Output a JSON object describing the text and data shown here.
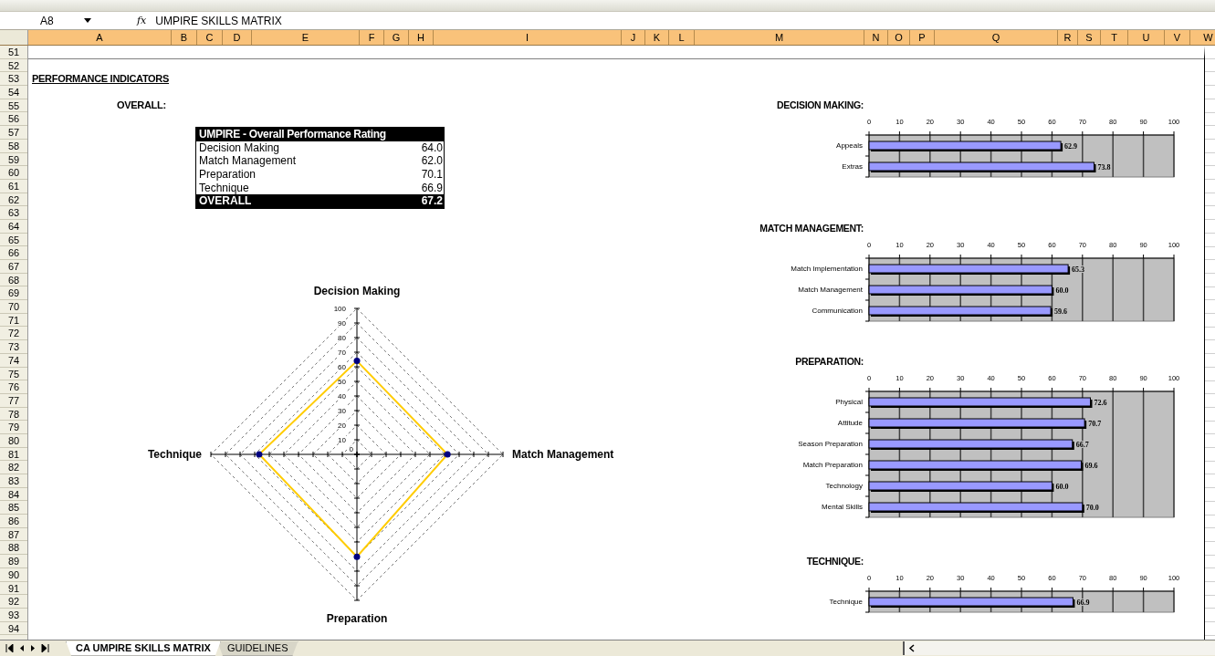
{
  "formula_bar": {
    "name_box": "A8",
    "function_label": "fx",
    "formula": "UMPIRE SKILLS MATRIX"
  },
  "columns": [
    "A",
    "B",
    "C",
    "D",
    "E",
    "F",
    "G",
    "H",
    "I",
    "J",
    "K",
    "L",
    "M",
    "N",
    "O",
    "P",
    "Q",
    "R",
    "S",
    "T",
    "U",
    "V",
    "W"
  ],
  "rows": [
    "51",
    "52",
    "53",
    "54",
    "55",
    "56",
    "57",
    "58",
    "59",
    "60",
    "61",
    "62",
    "63",
    "64",
    "65",
    "66",
    "67",
    "68",
    "69",
    "70",
    "71",
    "72",
    "73",
    "74",
    "75",
    "76",
    "77",
    "78",
    "79",
    "80",
    "81",
    "82",
    "83",
    "84",
    "85",
    "86",
    "87",
    "88",
    "89",
    "90",
    "91",
    "92",
    "93",
    "94"
  ],
  "heading": "PERFORMANCE INDICATORS",
  "overall_label": "OVERALL:",
  "rating_table": {
    "title": "UMPIRE - Overall Performance Rating",
    "rows": [
      {
        "label": "Decision Making",
        "value": "64.0"
      },
      {
        "label": "Match Management",
        "value": "62.0"
      },
      {
        "label": "Preparation",
        "value": "70.1"
      },
      {
        "label": "Technique",
        "value": "66.9"
      }
    ],
    "total": {
      "label": "OVERALL",
      "value": "67.2"
    }
  },
  "radar_chart": {
    "chart_data": {
      "type": "radar",
      "categories": [
        "Decision Making",
        "Match Management",
        "Preparation",
        "Technique"
      ],
      "series": [
        {
          "color": "#ffcc00",
          "values": [
            64.0,
            62.0,
            70.1,
            66.9
          ]
        }
      ],
      "ylim": [
        0,
        100
      ],
      "yticks": [
        0,
        10,
        20,
        30,
        40,
        50,
        60,
        70,
        80,
        90,
        100
      ]
    }
  },
  "skill_charts": [
    {
      "heading": "DECISION MAKING:",
      "chart_data": {
        "type": "bar",
        "orientation": "horizontal",
        "categories": [
          "Appeals",
          "Extras"
        ],
        "values": [
          62.9,
          73.8
        ],
        "xlim": [
          0,
          100
        ],
        "xticks": [
          0,
          10,
          20,
          30,
          40,
          50,
          60,
          70,
          80,
          90,
          100
        ],
        "grid": true,
        "value_labels": [
          "62.9",
          "73.8"
        ]
      }
    },
    {
      "heading": "MATCH MANAGEMENT:",
      "chart_data": {
        "type": "bar",
        "orientation": "horizontal",
        "categories": [
          "Match Implementation",
          "Match Management",
          "Communication"
        ],
        "values": [
          65.3,
          60.0,
          59.6
        ],
        "xlim": [
          0,
          100
        ],
        "xticks": [
          0,
          10,
          20,
          30,
          40,
          50,
          60,
          70,
          80,
          90,
          100
        ],
        "grid": true,
        "value_labels": [
          "65.3",
          "60.0",
          "59.6"
        ]
      }
    },
    {
      "heading": "PREPARATION:",
      "chart_data": {
        "type": "bar",
        "orientation": "horizontal",
        "categories": [
          "Physical",
          "Attitude",
          "Season Preparation",
          "Match Preparation",
          "Technology",
          "Mental Skills"
        ],
        "values": [
          72.6,
          70.7,
          66.7,
          69.6,
          60.0,
          70.0
        ],
        "xlim": [
          0,
          100
        ],
        "xticks": [
          0,
          10,
          20,
          30,
          40,
          50,
          60,
          70,
          80,
          90,
          100
        ],
        "grid": true,
        "value_labels": [
          "72.6",
          "70.7",
          "66.7",
          "69.6",
          "60.0",
          "70.0"
        ]
      }
    },
    {
      "heading": "TECHNIQUE:",
      "chart_data": {
        "type": "bar",
        "orientation": "horizontal",
        "categories": [
          "Technique"
        ],
        "values": [
          66.9
        ],
        "xlim": [
          0,
          100
        ],
        "xticks": [
          0,
          10,
          20,
          30,
          40,
          50,
          60,
          70,
          80,
          90,
          100
        ],
        "grid": true,
        "value_labels": [
          "66.9"
        ]
      }
    }
  ],
  "sheet_tabs": [
    {
      "label": "CA UMPIRE SKILLS MATRIX",
      "selected": true
    },
    {
      "label": "GUIDELINES",
      "selected": false
    }
  ]
}
